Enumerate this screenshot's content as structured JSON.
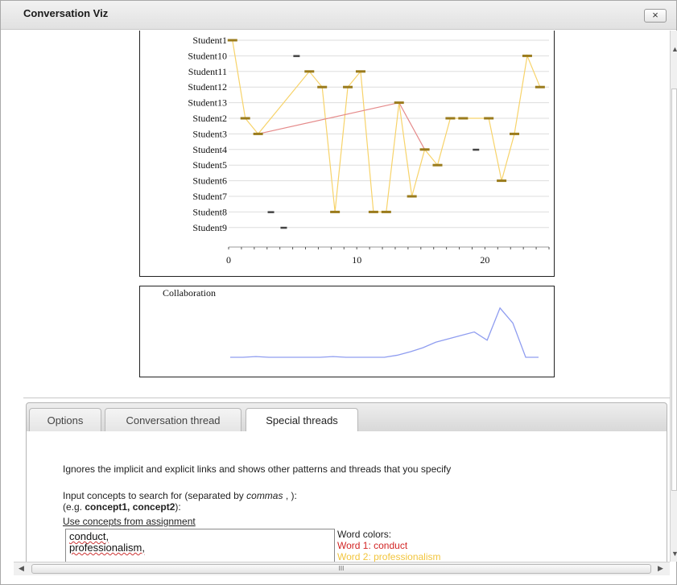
{
  "window": {
    "title": "Conversation Viz",
    "close_label": "×"
  },
  "chart_data": [
    {
      "type": "line",
      "x": [
        0,
        1,
        2,
        3,
        4,
        5,
        6,
        7,
        8,
        9,
        10,
        11,
        12,
        13,
        14,
        15,
        16,
        17,
        18,
        19,
        20,
        21,
        22,
        23,
        24,
        25
      ],
      "categories": [
        "Student1",
        "Student10",
        "Student11",
        "Student12",
        "Student13",
        "Student2",
        "Student3",
        "Student4",
        "Student5",
        "Student6",
        "Student7",
        "Student8",
        "Student9"
      ],
      "xticks": [
        "0",
        "10",
        "20"
      ],
      "xlim": [
        0,
        25
      ],
      "points": [
        {
          "x": 0.3,
          "y": "Student1"
        },
        {
          "x": 1.3,
          "y": "Student2"
        },
        {
          "x": 2.3,
          "y": "Student3"
        },
        {
          "x": 6.3,
          "y": "Student11"
        },
        {
          "x": 7.3,
          "y": "Student12"
        },
        {
          "x": 8.3,
          "y": "Student8"
        },
        {
          "x": 9.3,
          "y": "Student12"
        },
        {
          "x": 10.3,
          "y": "Student11"
        },
        {
          "x": 11.3,
          "y": "Student8"
        },
        {
          "x": 12.3,
          "y": "Student8"
        },
        {
          "x": 13.3,
          "y": "Student13"
        },
        {
          "x": 14.3,
          "y": "Student7"
        },
        {
          "x": 15.3,
          "y": "Student4"
        },
        {
          "x": 16.3,
          "y": "Student5"
        },
        {
          "x": 17.3,
          "y": "Student2"
        },
        {
          "x": 18.3,
          "y": "Student2"
        },
        {
          "x": 20.3,
          "y": "Student2"
        },
        {
          "x": 21.3,
          "y": "Student6"
        },
        {
          "x": 22.3,
          "y": "Student3"
        },
        {
          "x": 23.3,
          "y": "Student10"
        },
        {
          "x": 24.3,
          "y": "Student12"
        }
      ],
      "isolated_points": [
        {
          "x": 3.3,
          "y": "Student8"
        },
        {
          "x": 4.3,
          "y": "Student9"
        },
        {
          "x": 5.3,
          "y": "Student10"
        },
        {
          "x": 19.3,
          "y": "Student4"
        }
      ],
      "red_path": [
        {
          "x": 2.3,
          "y": "Student3"
        },
        {
          "x": 13.3,
          "y": "Student13"
        },
        {
          "x": 15.3,
          "y": "Student4"
        }
      ],
      "colors": {
        "thread": "#f7d36a",
        "special": "#e58a8a",
        "marker": "#9a7b1c",
        "marker_dark": "#444444",
        "grid": "#dddddd"
      }
    },
    {
      "type": "line",
      "title": "Collaboration",
      "x": [
        0,
        1,
        2,
        3,
        4,
        5,
        6,
        7,
        8,
        9,
        10,
        11,
        12,
        13,
        14,
        15,
        16,
        17,
        18,
        19,
        20,
        21,
        22,
        23,
        24
      ],
      "values": [
        0,
        0,
        0.01,
        0,
        0,
        0,
        0,
        0,
        0.01,
        0,
        0,
        0,
        0,
        0.03,
        0.08,
        0.14,
        0.22,
        0.27,
        0.32,
        0.37,
        0.25,
        0.72,
        0.5,
        0,
        0
      ],
      "ylim": [
        0,
        0.8
      ],
      "color": "#8f9df0"
    }
  ],
  "tabs": [
    {
      "label": "Options",
      "active": false
    },
    {
      "label": "Conversation thread",
      "active": false
    },
    {
      "label": "Special threads",
      "active": true
    }
  ],
  "panel": {
    "description": "Ignores the implicit and explicit links and shows other patterns and threads that you specify",
    "prompt_line1_a": "Input concepts to search for (separated by ",
    "prompt_line1_em": "commas",
    "prompt_line1_b": " , ):",
    "prompt_line2_a": "(e.g. ",
    "prompt_line2_strong": "concept1, concept2",
    "prompt_line2_b": "):",
    "assignment_link": "Use concepts from assignment",
    "concepts": [
      "conduct,",
      "professionalism,"
    ],
    "word_colors_label": "Word colors:",
    "word1": "Word 1: conduct",
    "word1_color": "#d22424",
    "word2": "Word 2: professionalism",
    "word2_color": "#f2c53d"
  },
  "scrollbar": {
    "thumb_label": "III"
  }
}
